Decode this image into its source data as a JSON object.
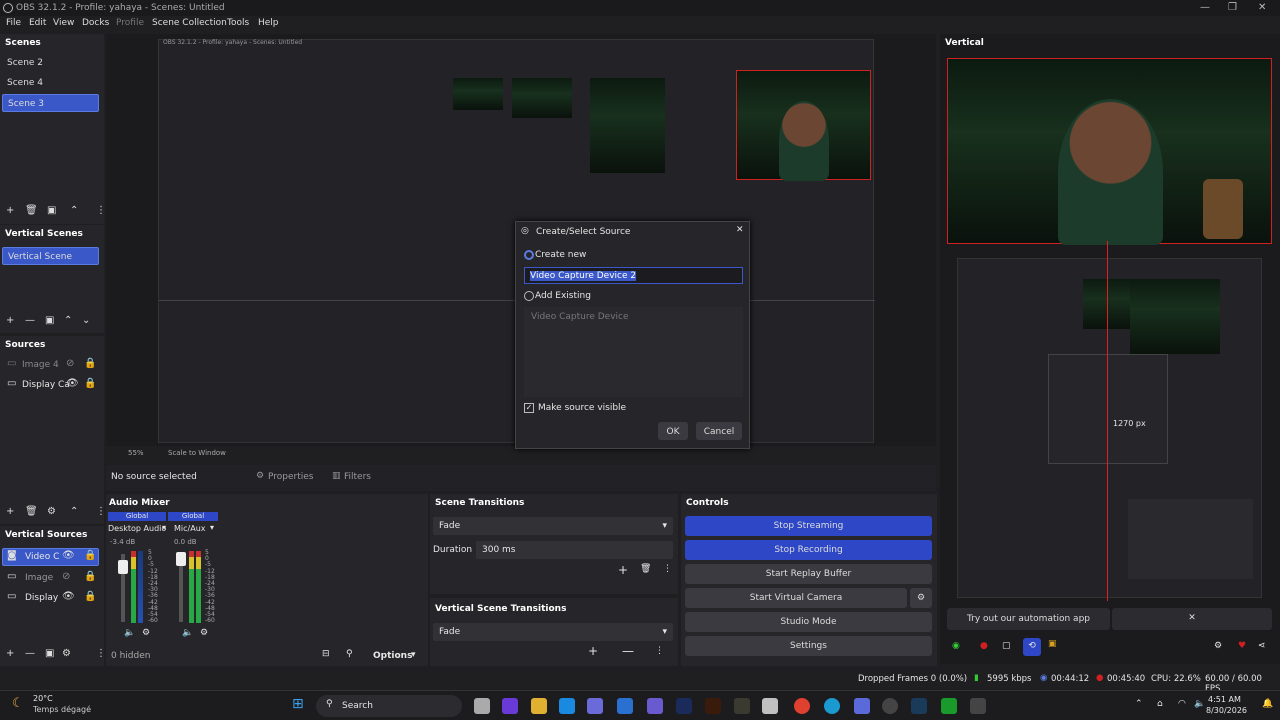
{
  "window": {
    "title": "OBS 32.1.2 - Profile: yahaya - Scenes: Untitled"
  },
  "menu": [
    "File",
    "Edit",
    "View",
    "Docks",
    "Profile",
    "Scene Collection",
    "Tools",
    "Help"
  ],
  "scenes": {
    "title": "Scenes",
    "items": [
      "Scene 2",
      "Scene 4",
      "Scene 3"
    ],
    "selected": "Scene 3"
  },
  "vertical_scenes": {
    "title": "Vertical Scenes",
    "items": [
      "Vertical Scene"
    ]
  },
  "sources": {
    "title": "Sources",
    "items": [
      "Image 4",
      "Display Ca"
    ]
  },
  "vertical_sources": {
    "title": "Vertical Sources",
    "items": [
      "Video C",
      "Image",
      "Display"
    ]
  },
  "preview": {
    "zoom": "55%",
    "scale": "Scale to Window",
    "no_source": "No source selected",
    "properties": "Properties",
    "filters": "Filters"
  },
  "vertical": {
    "title": "Vertical",
    "px_label": "1270 px",
    "automation": "Try out our automation app"
  },
  "audio": {
    "title": "Audio Mixer",
    "channels": [
      {
        "global": "Global",
        "name": "Desktop Audio",
        "db": "-3.4 dB"
      },
      {
        "global": "Global",
        "name": "Mic/Aux",
        "db": "0.0 dB"
      }
    ],
    "scale": [
      "5",
      "0",
      "-5",
      "-12",
      "-18",
      "-24",
      "-30",
      "-36",
      "-42",
      "-48",
      "-54",
      "-60"
    ],
    "hidden": "0 hidden",
    "options": "Options"
  },
  "transitions": {
    "title": "Scene Transitions",
    "fade": "Fade",
    "duration_label": "Duration",
    "duration": "300 ms"
  },
  "vertical_transitions": {
    "title": "Vertical Scene Transitions",
    "fade": "Fade"
  },
  "controls": {
    "title": "Controls",
    "buttons": [
      "Stop Streaming",
      "Stop Recording",
      "Start Replay Buffer",
      "Start Virtual Camera",
      "Studio Mode",
      "Settings"
    ]
  },
  "dialog": {
    "title": "Create/Select Source",
    "create_new": "Create new",
    "name_value": "Video Capture Device 2",
    "add_existing": "Add Existing",
    "existing_item": "Video Capture Device",
    "make_visible": "Make source visible",
    "ok": "OK",
    "cancel": "Cancel"
  },
  "status": {
    "dropped": "Dropped Frames 0 (0.0%)",
    "bitrate": "5995 kbps",
    "stream_time": "00:44:12",
    "rec_time": "00:45:40",
    "cpu": "CPU: 22.6%",
    "fps": "60.00 / 60.00 FPS"
  },
  "taskbar": {
    "temp": "20°C",
    "weather": "Temps dégagé",
    "search": "Search",
    "time": "4:51 AM",
    "date": "8/30/2026"
  },
  "colors": {
    "accent": "#3a58c7",
    "record": "#d02020",
    "bg": "#1f1f22"
  }
}
